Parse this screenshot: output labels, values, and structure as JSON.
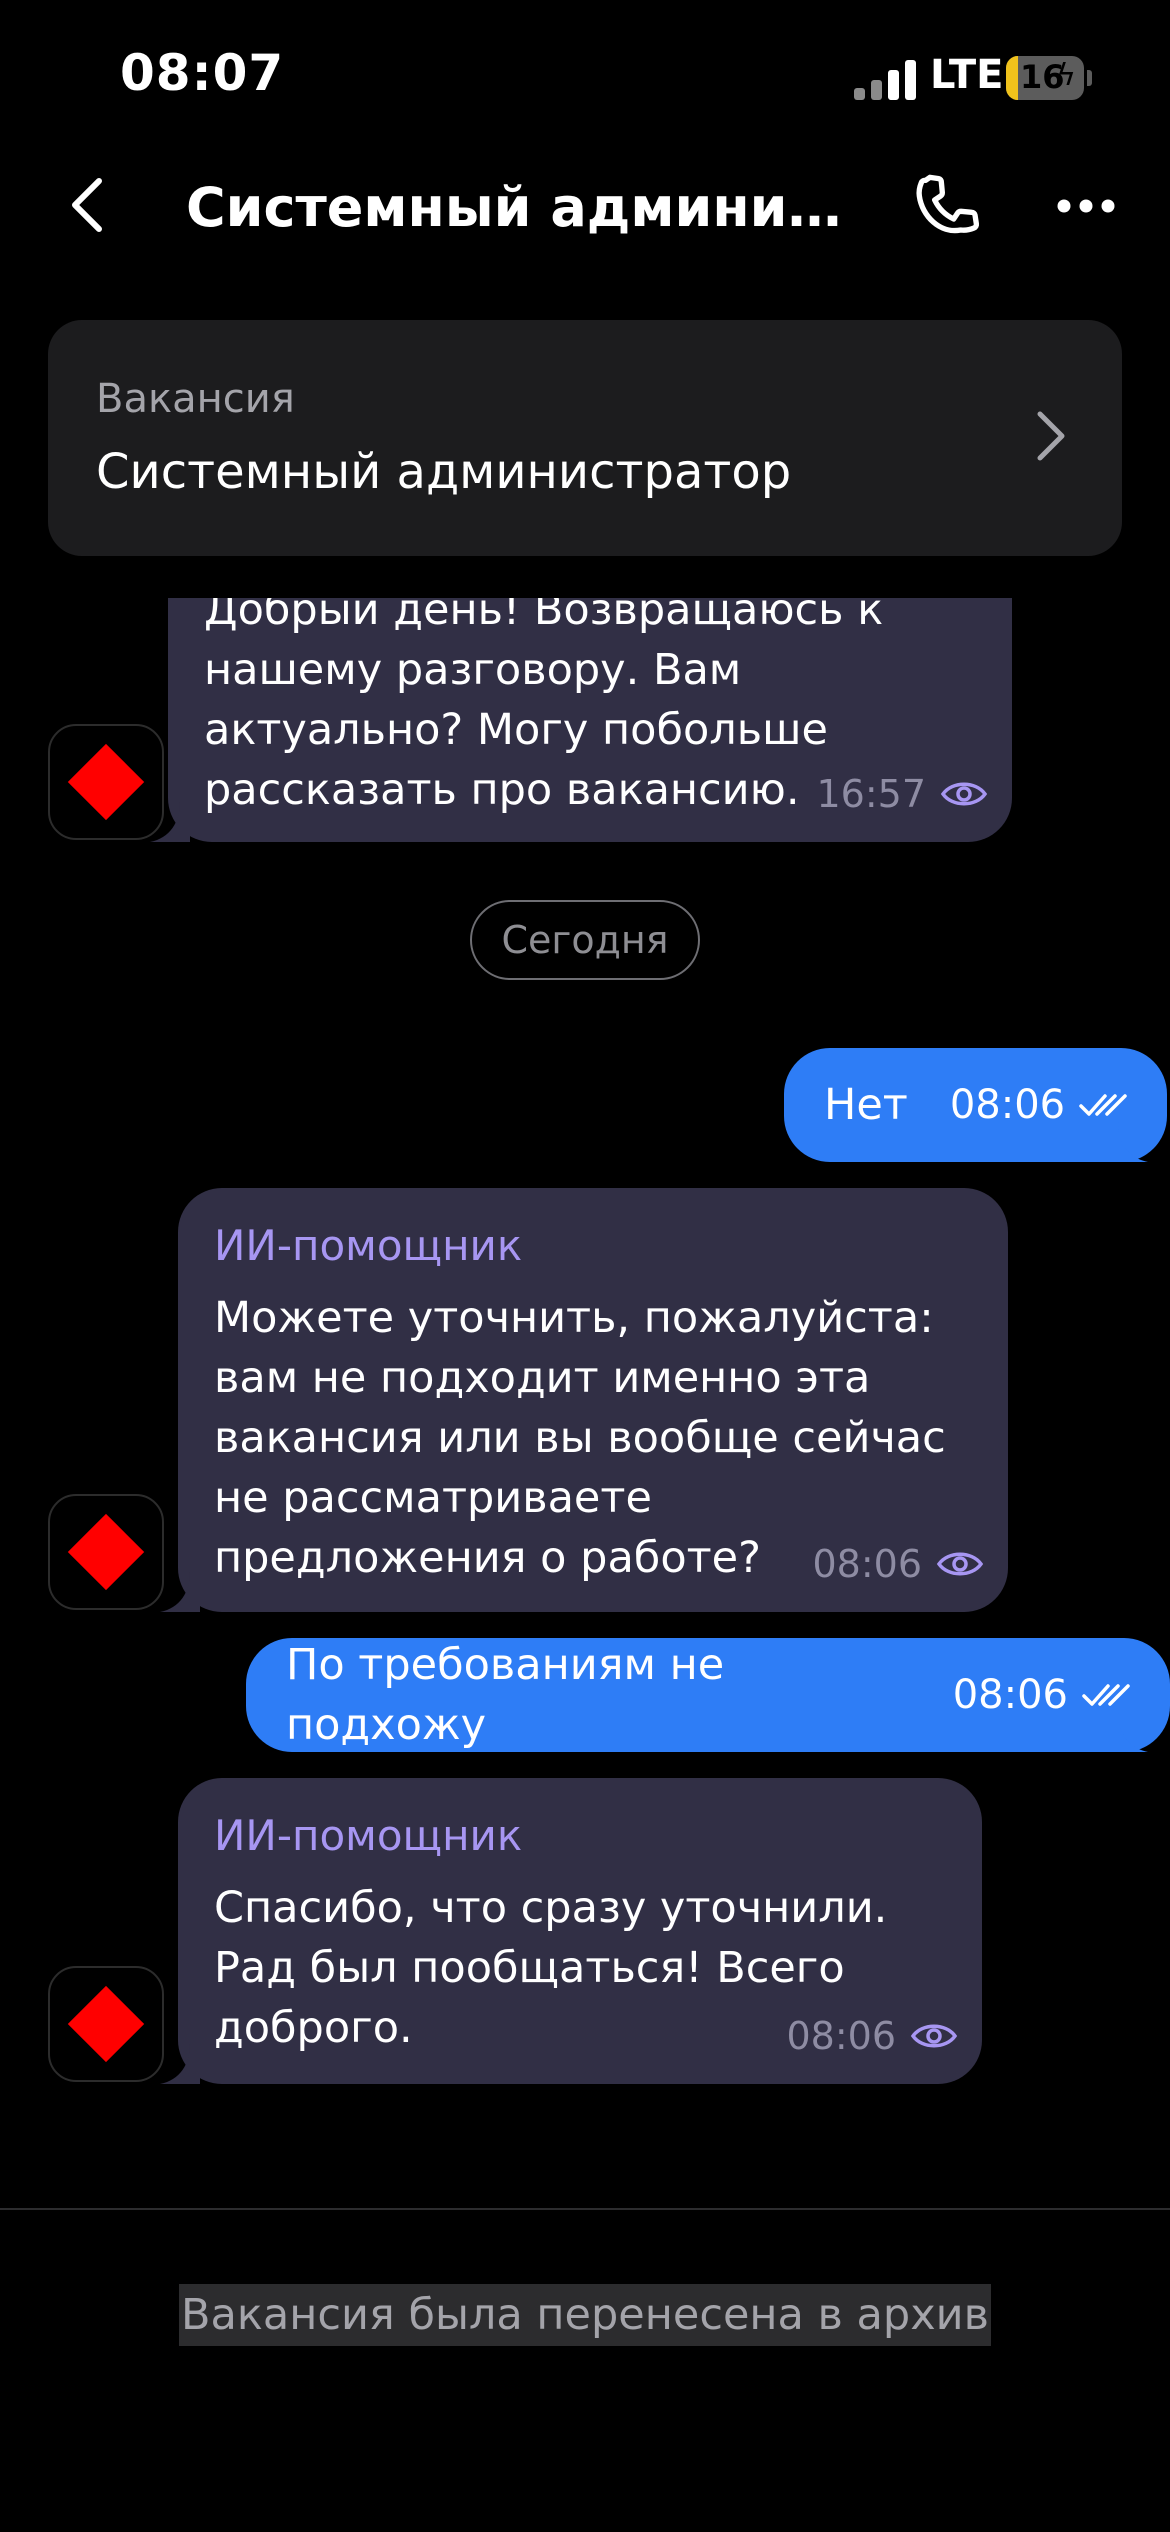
{
  "status_bar": {
    "time": "08:07",
    "network": "LTE",
    "battery": "16",
    "battery_level": 0.16
  },
  "header": {
    "title": "Системный администратор"
  },
  "vacancy": {
    "label": "Вакансия",
    "title": "Системный администратор"
  },
  "messages": [
    {
      "text": "Добрый день! Возвращаюсь к нашему разговору. Вам актуально? Могу побольше рассказать про вакансию.",
      "time": "16:57"
    },
    {
      "date": "Сегодня"
    },
    {
      "text": "Нет",
      "time": "08:06"
    },
    {
      "sender": "ИИ-помощник",
      "text": "Можете уточнить, пожалуйста: вам не подходит именно эта вакансия или вы вообще сейчас не рассматриваете предложения о работе?",
      "time": "08:06"
    },
    {
      "text": "По требованиям не подхожу",
      "time": "08:06"
    },
    {
      "sender": "ИИ-помощник",
      "text": "Спасибо, что сразу уточнили. Рад был пообщаться! Всего доброго.",
      "time": "08:06"
    }
  ],
  "footer": {
    "notice": "Вакансия была перенесена в архив"
  },
  "colors": {
    "background": "#000000",
    "incoming_bubble": "#312f45",
    "outgoing_bubble": "#2e7df6",
    "sender_accent": "#a796f2",
    "avatar_mark": "#ff0000"
  }
}
